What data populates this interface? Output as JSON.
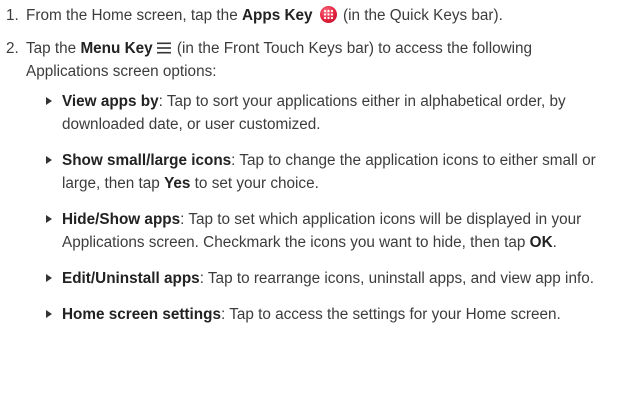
{
  "steps": [
    {
      "number": "1.",
      "text_before": "From the Home screen, tap the ",
      "key_label": "Apps Key",
      "text_after": " (in the Quick Keys bar)."
    },
    {
      "number": "2.",
      "text_before": "Tap the ",
      "key_label": "Menu Key",
      "text_after": " (in the Front Touch Keys bar) to access the following Applications screen options:"
    }
  ],
  "options": [
    {
      "term": "View apps by",
      "desc": ": Tap to sort your applications either in alphabetical order, by downloaded date, or user customized."
    },
    {
      "term": "Show small/large icons",
      "desc_before": ": Tap to change the application icons to either small or large, then tap ",
      "emph": "Yes",
      "desc_after": " to set your choice."
    },
    {
      "term": "Hide/Show apps",
      "desc_before": ": Tap to set which application icons will be displayed in your Applications screen. Checkmark the icons you want to hide, then tap ",
      "emph": "OK",
      "desc_after": "."
    },
    {
      "term": "Edit/Uninstall apps",
      "desc": ": Tap to rearrange icons, uninstall apps, and view app info."
    },
    {
      "term": "Home screen settings",
      "desc": ": Tap to access the settings for your Home screen."
    }
  ],
  "icons": {
    "apps_key": "apps-key-icon",
    "menu_key": "menu-key-icon",
    "bullet": "triangle-bullet-icon"
  },
  "colors": {
    "apps_key_red": "#e0203c",
    "text": "#3c3c3c"
  }
}
